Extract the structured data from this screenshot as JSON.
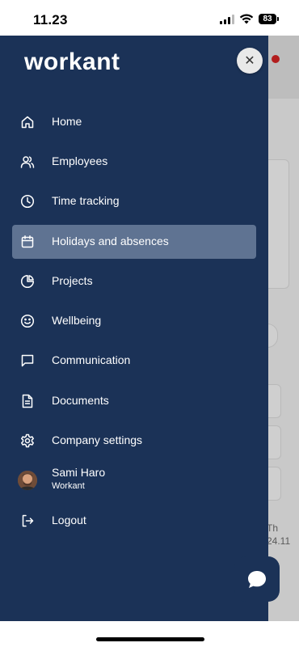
{
  "status": {
    "time": "11.23",
    "battery": "83"
  },
  "drawer": {
    "logo": "workant",
    "close_symbol": "✕",
    "items": [
      {
        "label": "Home",
        "icon": "home-icon"
      },
      {
        "label": "Employees",
        "icon": "users-icon"
      },
      {
        "label": "Time tracking",
        "icon": "clock-icon"
      },
      {
        "label": "Holidays and absences",
        "icon": "calendar-icon",
        "active": true
      },
      {
        "label": "Projects",
        "icon": "pie-chart-icon"
      },
      {
        "label": "Wellbeing",
        "icon": "smile-icon"
      },
      {
        "label": "Communication",
        "icon": "message-icon"
      },
      {
        "label": "Documents",
        "icon": "document-icon"
      },
      {
        "label": "Company settings",
        "icon": "gear-icon"
      }
    ],
    "user": {
      "name": "Sami Haro",
      "company": "Workant"
    },
    "logout_label": "Logout"
  },
  "background": {
    "text_day": "Th",
    "text_date": "24.11"
  },
  "colors": {
    "drawer": "#1b3257",
    "active_item": "#5f7392",
    "notification_dot": "#b21d1d"
  }
}
